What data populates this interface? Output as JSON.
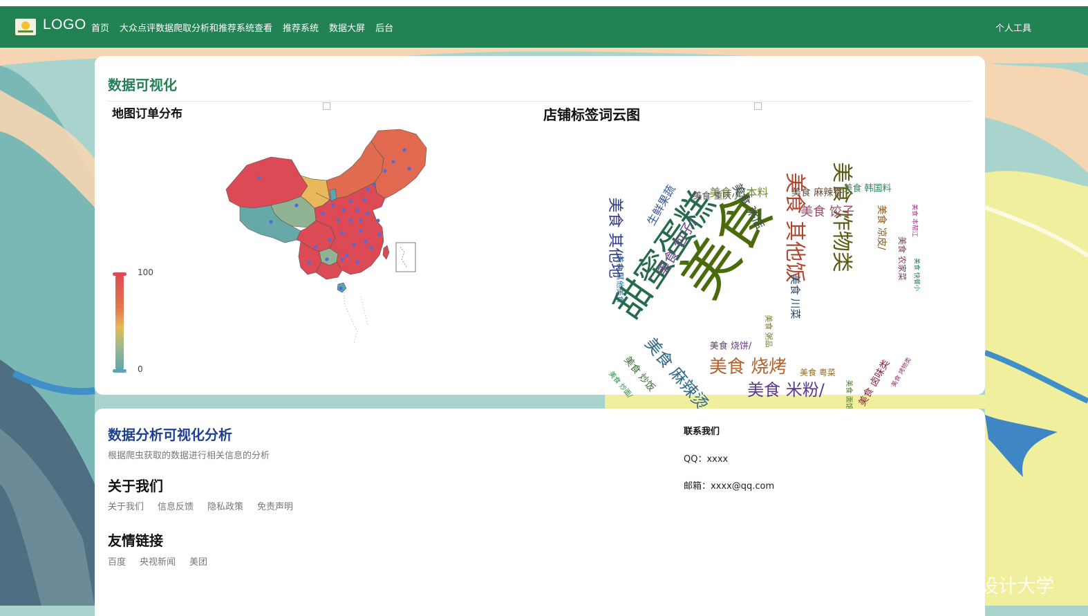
{
  "nav": {
    "logo_text": "LOGO",
    "items": [
      "首页",
      "大众点评数据爬取分析和推荐系统查看",
      "推荐系统",
      "数据大屏",
      "后台"
    ],
    "right": "个人工具"
  },
  "visual": {
    "section_title": "数据可视化",
    "map_title": "地图订单分布",
    "cloud_title": "店铺标签词云图",
    "legend_max": "100",
    "legend_min": "0",
    "colors": {
      "nav": "#238253",
      "map_high": "#dc4b55",
      "map_mid": "#e8b85a",
      "map_low": "#5ba5b0",
      "map_point": "#4f6bd8"
    },
    "wordcloud": [
      {
        "text": "美食",
        "color": "#4a6b0a"
      },
      {
        "text": "甜蜜蛋糕",
        "color": "#256b4b"
      },
      {
        "text": "美食 其他饭",
        "color": "#b0462e"
      },
      {
        "text": "美食 炸物类",
        "color": "#5a5a12"
      },
      {
        "text": "美食 烧烤",
        "color": "#b4622c"
      },
      {
        "text": "美食 米粉/",
        "color": "#5a3a8a"
      },
      {
        "text": "美食 麻辣烫",
        "color": "#2f6a8a"
      },
      {
        "text": "美食 其他地",
        "color": "#2f3a8a"
      },
      {
        "text": "美食 包子/",
        "color": "#6a4a8a"
      },
      {
        "text": "美食 饺子",
        "color": "#a04a6a"
      },
      {
        "text": "美食 日本料",
        "color": "#6a8a2a"
      },
      {
        "text": "美食 重庆小",
        "color": "#555555"
      },
      {
        "text": "美食 麻辣香",
        "color": "#6a4a3a"
      },
      {
        "text": "美食 韩国料",
        "color": "#2a8a5a"
      },
      {
        "text": "生鲜果蔬",
        "color": "#3a5a9a"
      },
      {
        "text": "美食 粥店",
        "color": "#3a4a5a"
      },
      {
        "text": "美食 凉皮/",
        "color": "#8a5a2a"
      },
      {
        "text": "美食 农家菜",
        "color": "#8a3a5a"
      },
      {
        "text": "美食 川菜",
        "color": "#2a4a6a"
      },
      {
        "text": "美食 卤味类",
        "color": "#8a2a4a"
      },
      {
        "text": "美食 烧饼/",
        "color": "#6a3a8a"
      },
      {
        "text": "美食 粤菜",
        "color": "#8a6a2a"
      },
      {
        "text": "美食 炒饭",
        "color": "#3a6a3a"
      },
      {
        "text": "美食 炒面/",
        "color": "#2a8a4a"
      },
      {
        "text": "美食 本帮江",
        "color": "#a03a8a"
      },
      {
        "text": "美食 快餐小",
        "color": "#2a7a6a"
      },
      {
        "text": "美食 烤物类",
        "color": "#9a3a7a"
      },
      {
        "text": "美食 其他美食",
        "color": "#2a6a9a"
      },
      {
        "text": "美食 粥品",
        "color": "#7a7a3a"
      },
      {
        "text": "美食 面馆",
        "color": "#4a7a2a"
      }
    ]
  },
  "about": {
    "title": "数据分析可视化分析",
    "subtitle": "根据爬虫获取的数据进行相关信息的分析",
    "about_title": "关于我们",
    "about_links": [
      "关于我们",
      "信息反馈",
      "隐私政策",
      "免责声明"
    ],
    "friend_title": "友情链接",
    "friend_links": [
      "百度",
      "央视新闻",
      "美团"
    ],
    "contact_title": "联系我们",
    "qq": "QQ：xxxx",
    "email": "邮箱：xxxx@qq.com"
  },
  "watermark": "CSDN @B站计算机毕业设计大学"
}
